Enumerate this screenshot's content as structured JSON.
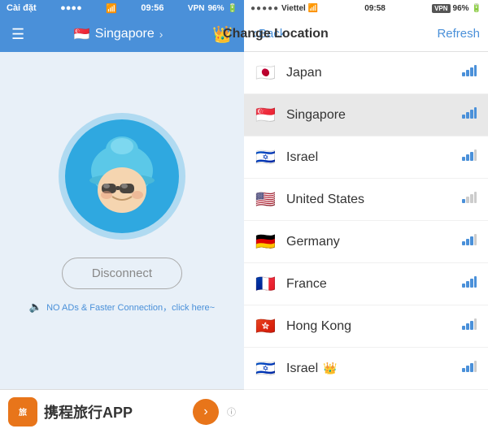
{
  "left": {
    "statusBar": {
      "appName": "Cài đặt",
      "dots": "●●●●",
      "wifiIcon": "WiFi",
      "time": "09:56",
      "vpn": "VPN",
      "battery": "96%"
    },
    "header": {
      "location": "Singapore",
      "chevron": "›"
    },
    "disconnect_label": "Disconnect",
    "ads_text": "NO ADs & Faster Connection，click here~",
    "ad_banner_text": "携程旅行APP"
  },
  "right": {
    "statusBar": {
      "dots": "●●●●●",
      "carrier": "Viettel",
      "vpn": "VPN",
      "time": "09:58",
      "battery": "96%"
    },
    "header": {
      "back": "Back",
      "title": "Change Location",
      "refresh": "Refresh"
    },
    "locations": [
      {
        "name": "Japan",
        "flag": "🇯🇵",
        "signal": "strong",
        "active": false,
        "crown": false
      },
      {
        "name": "Singapore",
        "flag": "🇸🇬",
        "signal": "strong",
        "active": true,
        "crown": false
      },
      {
        "name": "Israel",
        "flag": "🇮🇱",
        "signal": "medium",
        "active": false,
        "crown": false
      },
      {
        "name": "United States",
        "flag": "🇺🇸",
        "signal": "weak",
        "active": false,
        "crown": false
      },
      {
        "name": "Germany",
        "flag": "🇩🇪",
        "signal": "medium",
        "active": false,
        "crown": false
      },
      {
        "name": "France",
        "flag": "🇫🇷",
        "signal": "strong",
        "active": false,
        "crown": false
      },
      {
        "name": "Hong Kong",
        "flag": "🇭🇰",
        "signal": "medium",
        "active": false,
        "crown": false
      },
      {
        "name": "Israel",
        "flag": "🇮🇱",
        "signal": "medium",
        "active": false,
        "crown": true
      }
    ]
  }
}
